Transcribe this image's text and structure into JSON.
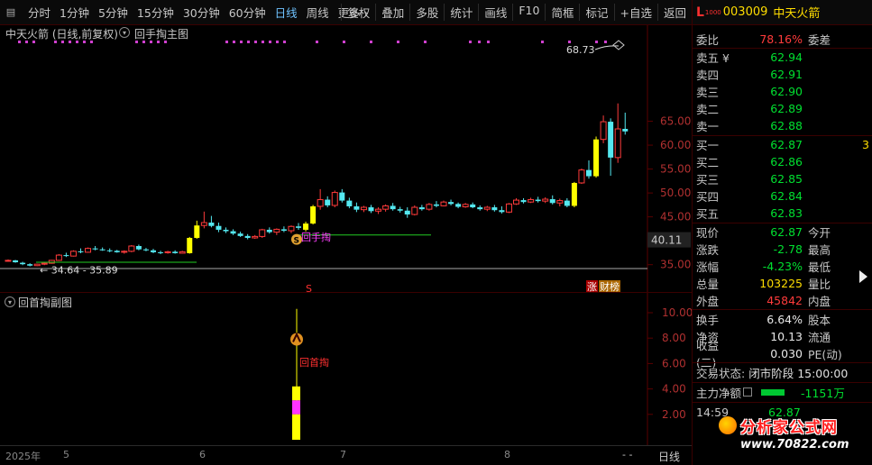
{
  "toolbar": {
    "periods": [
      "分时",
      "1分钟",
      "5分钟",
      "15分钟",
      "30分钟",
      "60分钟",
      "日线",
      "周线",
      "更多 ›"
    ],
    "active_index": 6,
    "actions": [
      "复权",
      "叠加",
      "多股",
      "统计",
      "画线",
      "F10",
      "简框",
      "标记",
      "+自选",
      "返回"
    ]
  },
  "main_chart": {
    "title": "中天火箭 (日线,前复权)",
    "formula": "回手掏主图",
    "high_label": "68.73",
    "low_label": "← 34.64 - 35.89",
    "signal_text": "回手掏",
    "marker_s": "S",
    "badge_zhang": "涨",
    "badge_bang": "财榜",
    "current_price_tag": "40.11",
    "y_ticks": [
      "65.00",
      "60.00",
      "55.00",
      "50.00",
      "45.00",
      "40.00",
      "35.00"
    ]
  },
  "sub_chart": {
    "title": "回首掏副图",
    "signal_label": "回首掏",
    "y_ticks": [
      "10.00",
      "8.00",
      "6.00",
      "4.00",
      "2.00"
    ]
  },
  "date_axis": {
    "labels": [
      "2025年",
      "5",
      "6",
      "7",
      "8"
    ],
    "period_tab": "日线"
  },
  "panel": {
    "logo": "L",
    "logo_sub": "1000",
    "code": "003009",
    "name": "中天火箭",
    "weibi_label": "委比",
    "weibi_value": "78.16%",
    "weicha_label": "委差",
    "asks": [
      {
        "label": "卖五 ¥",
        "price": "62.94"
      },
      {
        "label": "卖四",
        "price": "62.91"
      },
      {
        "label": "卖三",
        "price": "62.90"
      },
      {
        "label": "卖二",
        "price": "62.89"
      },
      {
        "label": "卖一",
        "price": "62.88"
      }
    ],
    "bids": [
      {
        "label": "买一",
        "price": "62.87",
        "extra": "3"
      },
      {
        "label": "买二",
        "price": "62.86"
      },
      {
        "label": "买三",
        "price": "62.85"
      },
      {
        "label": "买四",
        "price": "62.84"
      },
      {
        "label": "买五",
        "price": "62.83"
      }
    ],
    "stats": [
      {
        "l1": "现价",
        "v": "62.87",
        "l2": "今开",
        "color": "green"
      },
      {
        "l1": "涨跌",
        "v": "-2.78",
        "l2": "最高",
        "color": "green"
      },
      {
        "l1": "涨幅",
        "v": "-4.23%",
        "l2": "最低",
        "color": "green"
      },
      {
        "l1": "总量",
        "v": "103225",
        "l2": "量比",
        "color": "yellow"
      },
      {
        "l1": "外盘",
        "v": "45842",
        "l2": "内盘",
        "color": "red"
      }
    ],
    "stats2": [
      {
        "l1": "换手",
        "v": "6.64%",
        "l2": "股本"
      },
      {
        "l1": "净资",
        "v": "10.13",
        "l2": "流通"
      },
      {
        "l1": "收益(二)",
        "v": "0.030",
        "l2": "PE(动)"
      }
    ],
    "trade_status_label": "交易状态:",
    "trade_status_value": "闭市阶段 15:00:00",
    "net_flow_label": "主力净额",
    "net_flow_value": "-1151万",
    "tick_time": "14:59",
    "tick_price": "62.87"
  },
  "watermark": {
    "title": "分析家公式网",
    "url": "www.70822.com"
  },
  "colors": {
    "up": "#ff3b3b",
    "down": "#54e8f0",
    "signal": "#ffff00",
    "support": "#22cc22"
  }
}
